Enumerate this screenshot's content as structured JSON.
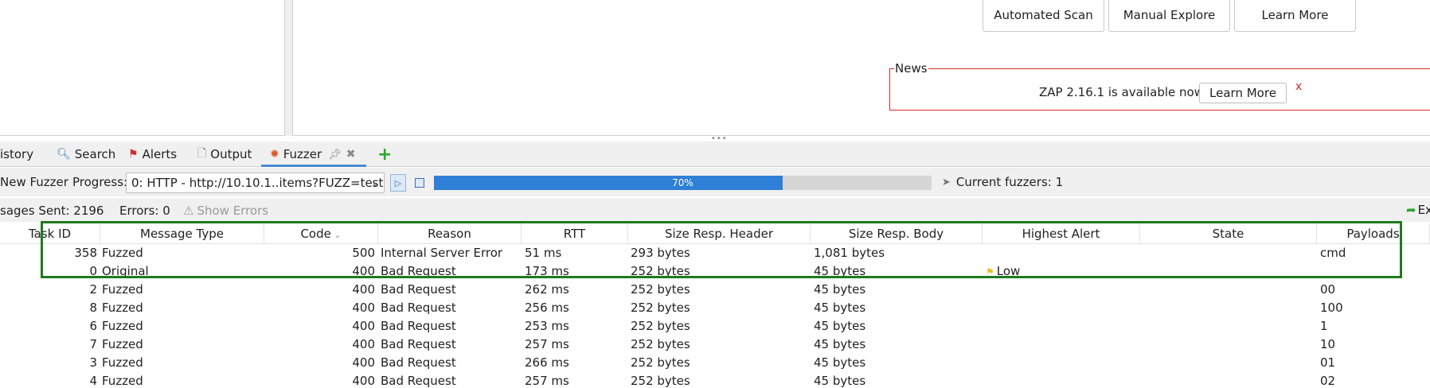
{
  "quickstart": {
    "automated_scan": "Automated Scan",
    "manual_explore": "Manual Explore",
    "learn_more": "Learn More"
  },
  "news": {
    "legend": "News",
    "text": "ZAP 2.16.1 is available now",
    "learn_more": "Learn More",
    "close": "x"
  },
  "tabs": {
    "history": "istory",
    "search": "Search",
    "alerts": "Alerts",
    "output": "Output",
    "fuzzer": "Fuzzer",
    "add": "+"
  },
  "toolbar": {
    "new_fuzzer": "New Fuzzer",
    "progress_label": "Progress:",
    "progress_select": "0: HTTP - http://10.10.1..items?FUZZ=test",
    "progress_percent": 70,
    "progress_text": "70%",
    "current_fuzzers": "Current fuzzers: 1"
  },
  "stats": {
    "messages_sent": "sages Sent: 2196",
    "errors": "Errors: 0",
    "show_errors": "Show Errors",
    "export": "Ex"
  },
  "table": {
    "headers": [
      "Task ID",
      "Message Type",
      "Code",
      "Reason",
      "RTT",
      "Size Resp. Header",
      "Size Resp. Body",
      "Highest Alert",
      "State",
      "Payloads"
    ],
    "rows": [
      {
        "id": "358",
        "type": "Fuzzed",
        "code": "500",
        "reason": "Internal Server Error",
        "rtt": "51 ms",
        "size_header": "293 bytes",
        "size_body": "1,081 bytes",
        "alert": "",
        "state": "",
        "payload": "cmd"
      },
      {
        "id": "0",
        "type": "Original",
        "code": "400",
        "reason": "Bad Request",
        "rtt": "173 ms",
        "size_header": "252 bytes",
        "size_body": "45 bytes",
        "alert": "Low",
        "state": "",
        "payload": ""
      },
      {
        "id": "2",
        "type": "Fuzzed",
        "code": "400",
        "reason": "Bad Request",
        "rtt": "262 ms",
        "size_header": "252 bytes",
        "size_body": "45 bytes",
        "alert": "",
        "state": "",
        "payload": "00"
      },
      {
        "id": "8",
        "type": "Fuzzed",
        "code": "400",
        "reason": "Bad Request",
        "rtt": "256 ms",
        "size_header": "252 bytes",
        "size_body": "45 bytes",
        "alert": "",
        "state": "",
        "payload": "100"
      },
      {
        "id": "6",
        "type": "Fuzzed",
        "code": "400",
        "reason": "Bad Request",
        "rtt": "253 ms",
        "size_header": "252 bytes",
        "size_body": "45 bytes",
        "alert": "",
        "state": "",
        "payload": "1"
      },
      {
        "id": "7",
        "type": "Fuzzed",
        "code": "400",
        "reason": "Bad Request",
        "rtt": "257 ms",
        "size_header": "252 bytes",
        "size_body": "45 bytes",
        "alert": "",
        "state": "",
        "payload": "10"
      },
      {
        "id": "3",
        "type": "Fuzzed",
        "code": "400",
        "reason": "Bad Request",
        "rtt": "266 ms",
        "size_header": "252 bytes",
        "size_body": "45 bytes",
        "alert": "",
        "state": "",
        "payload": "01"
      },
      {
        "id": "4",
        "type": "Fuzzed",
        "code": "400",
        "reason": "Bad Request",
        "rtt": "257 ms",
        "size_header": "252 bytes",
        "size_body": "45 bytes",
        "alert": "",
        "state": "",
        "payload": "02"
      }
    ]
  },
  "colors": {
    "highlight": "#1f7a1f",
    "progress": "#2f7fd6",
    "news_border": "#d52b2b"
  }
}
